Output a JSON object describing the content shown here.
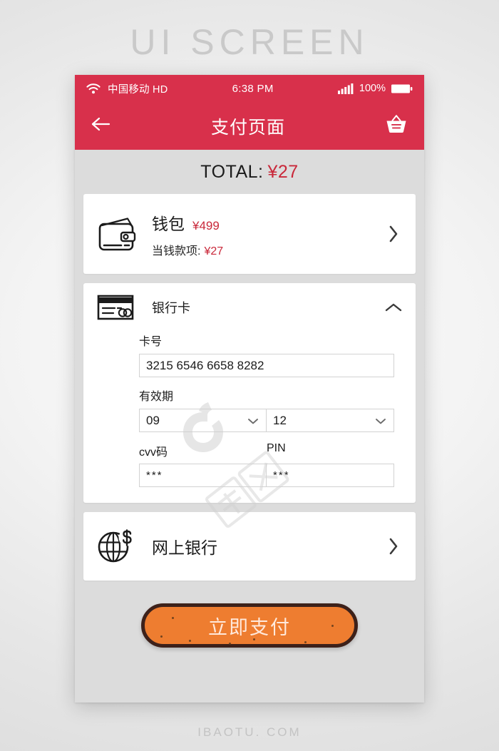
{
  "poster": {
    "title": "UI SCREEN",
    "footer_watermark": "IBAOTU. COM",
    "center_watermark": "包图网"
  },
  "status_bar": {
    "wifi_icon": "wifi-icon",
    "carrier": "中国移动 HD",
    "time": "6:38 PM",
    "signal_icon": "signal-bars-icon",
    "battery_percent": "100%",
    "battery_icon": "battery-full-icon"
  },
  "title_bar": {
    "back_icon": "arrow-left-icon",
    "title": "支付页面",
    "basket_icon": "shopping-basket-icon"
  },
  "total": {
    "label": "TOTAL:",
    "amount": "¥27"
  },
  "wallet": {
    "icon": "wallet-icon",
    "name": "钱包",
    "balance": "¥499",
    "due_label": "当钱款项:",
    "due_amount": "¥27",
    "chevron": "chevron-right-icon"
  },
  "bank_card": {
    "icon": "credit-card-icon",
    "label": "银行卡",
    "chevron": "chevron-up-icon",
    "expanded": true,
    "card_number": {
      "label": "卡号",
      "value": "3215 6546 6658 8282",
      "placeholder": "卡号"
    },
    "expiry": {
      "label": "有效期",
      "month": "09",
      "year": "12",
      "caret_icon": "chevron-down-icon"
    },
    "cvv": {
      "label": "cvv码",
      "value": "***"
    },
    "pin": {
      "label": "PIN",
      "value": "***"
    }
  },
  "online_bank": {
    "icon": "globe-dollar-icon",
    "label": "网上银行",
    "chevron": "chevron-right-icon"
  },
  "pay_button": {
    "label": "立即支付"
  },
  "colors": {
    "header_red": "#d8304b",
    "price_red": "#c9283a",
    "button_orange": "#ee7d30",
    "button_border": "#3d211a",
    "screen_bg": "#dcdcdc",
    "card_bg": "#ffffff"
  }
}
